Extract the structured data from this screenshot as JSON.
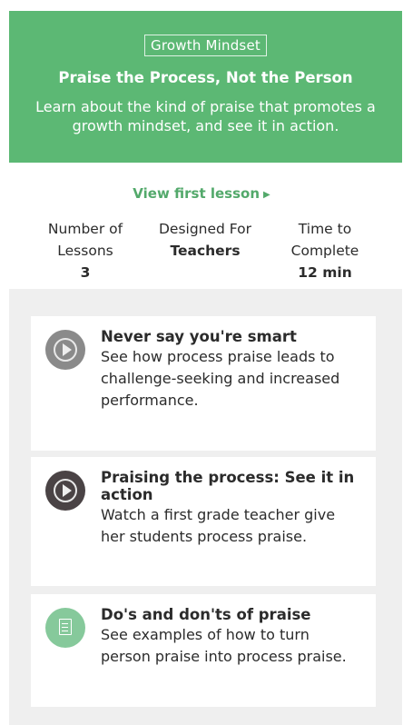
{
  "hero": {
    "tag": "Growth Mindset",
    "title": "Praise the Process, Not the Person",
    "description": "Learn about the kind of praise that promotes a growth mindset, and see it in action."
  },
  "cta": {
    "label": "View first lesson",
    "icon": "caret-right-icon"
  },
  "stats": [
    {
      "label": "Number of Lessons",
      "value": "3"
    },
    {
      "label": "Designed For",
      "value": "Teachers"
    },
    {
      "label": "Time to Complete",
      "value": "12 min"
    }
  ],
  "lessons": [
    {
      "title": "Never say you're smart",
      "description": "See how process praise leads to challenge-seeking and increased performance.",
      "icon": "play-icon"
    },
    {
      "title": "Praising the process: See it in action",
      "description": "Watch a first grade teacher give her students process praise.",
      "icon": "play-icon"
    },
    {
      "title": "Do's and don'ts of praise",
      "description": "See examples of how to turn person praise into process praise.",
      "icon": "document-icon"
    }
  ],
  "colors": {
    "brand_green": "#5cb874",
    "link_green": "#53a96b",
    "panel_gray": "#efefef"
  }
}
